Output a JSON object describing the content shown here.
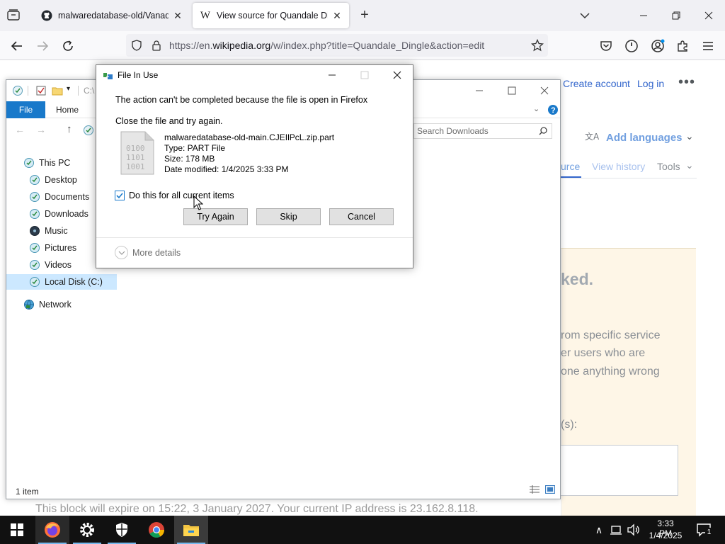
{
  "browser": {
    "tabs": [
      {
        "title": "malwaredatabase-old/Vanadiu",
        "favicon": "github-icon",
        "active": false
      },
      {
        "title": "View source for Quandale Dingl",
        "favicon": "wikipedia-icon",
        "active": true
      }
    ],
    "url": {
      "prefix": "https://en.",
      "domain": "wikipedia.org",
      "suffix": "/w/index.php?title=Quandale_Dingle&action=edit"
    }
  },
  "wiki": {
    "create_account": "Create account",
    "log_in": "Log in",
    "add_languages": "Add languages",
    "tab_source": "urce",
    "tab_view_history": "View history",
    "tools": "Tools",
    "blocked_title": "ked.",
    "blocked_lines": [
      "rom specific service",
      "er users who are",
      "one anything wrong"
    ],
    "reason_label": "(s):",
    "expire_text": "This block will expire on 15:22, 3 January 2027. Your current IP address is 23.162.8.118."
  },
  "explorer": {
    "path_stub": "C:\\",
    "ribbon": {
      "file": "File",
      "home": "Home"
    },
    "search_placeholder": "Search Downloads",
    "nav": [
      {
        "label": "This PC",
        "icon": "computer-icon"
      },
      {
        "label": "Desktop",
        "icon": "desktop-folder-icon"
      },
      {
        "label": "Documents",
        "icon": "documents-folder-icon"
      },
      {
        "label": "Downloads",
        "icon": "downloads-folder-icon"
      },
      {
        "label": "Music",
        "icon": "music-folder-icon"
      },
      {
        "label": "Pictures",
        "icon": "pictures-folder-icon"
      },
      {
        "label": "Videos",
        "icon": "videos-folder-icon"
      },
      {
        "label": "Local Disk (C:)",
        "icon": "disk-icon",
        "selected": true
      },
      {
        "label": "Network",
        "icon": "network-icon"
      }
    ],
    "status": "1 item"
  },
  "dialog": {
    "title": "File In Use",
    "message": "The action can't be completed because the file is open in Firefox",
    "instruction": "Close the file and try again.",
    "file": {
      "name": "malwaredatabase-old-main.CJEIlPcL.zip.part",
      "type": "Type: PART File",
      "size": "Size: 178 MB",
      "modified": "Date modified: 1/4/2025 3:33 PM"
    },
    "checkbox_label": "Do this for all current items",
    "checkbox_checked": true,
    "buttons": {
      "try_again": "Try Again",
      "skip": "Skip",
      "cancel": "Cancel"
    },
    "more_details": "More details"
  },
  "taskbar": {
    "apps": [
      "firefox-icon",
      "settings-gear-icon",
      "security-shield-icon",
      "chrome-icon",
      "file-explorer-icon"
    ],
    "time": "3:33 PM",
    "date": "1/4/2025",
    "notification_count": "1"
  },
  "colors": {
    "accent": "#1979ca",
    "wiki_link": "#3366cc",
    "taskbar": "#111111"
  }
}
